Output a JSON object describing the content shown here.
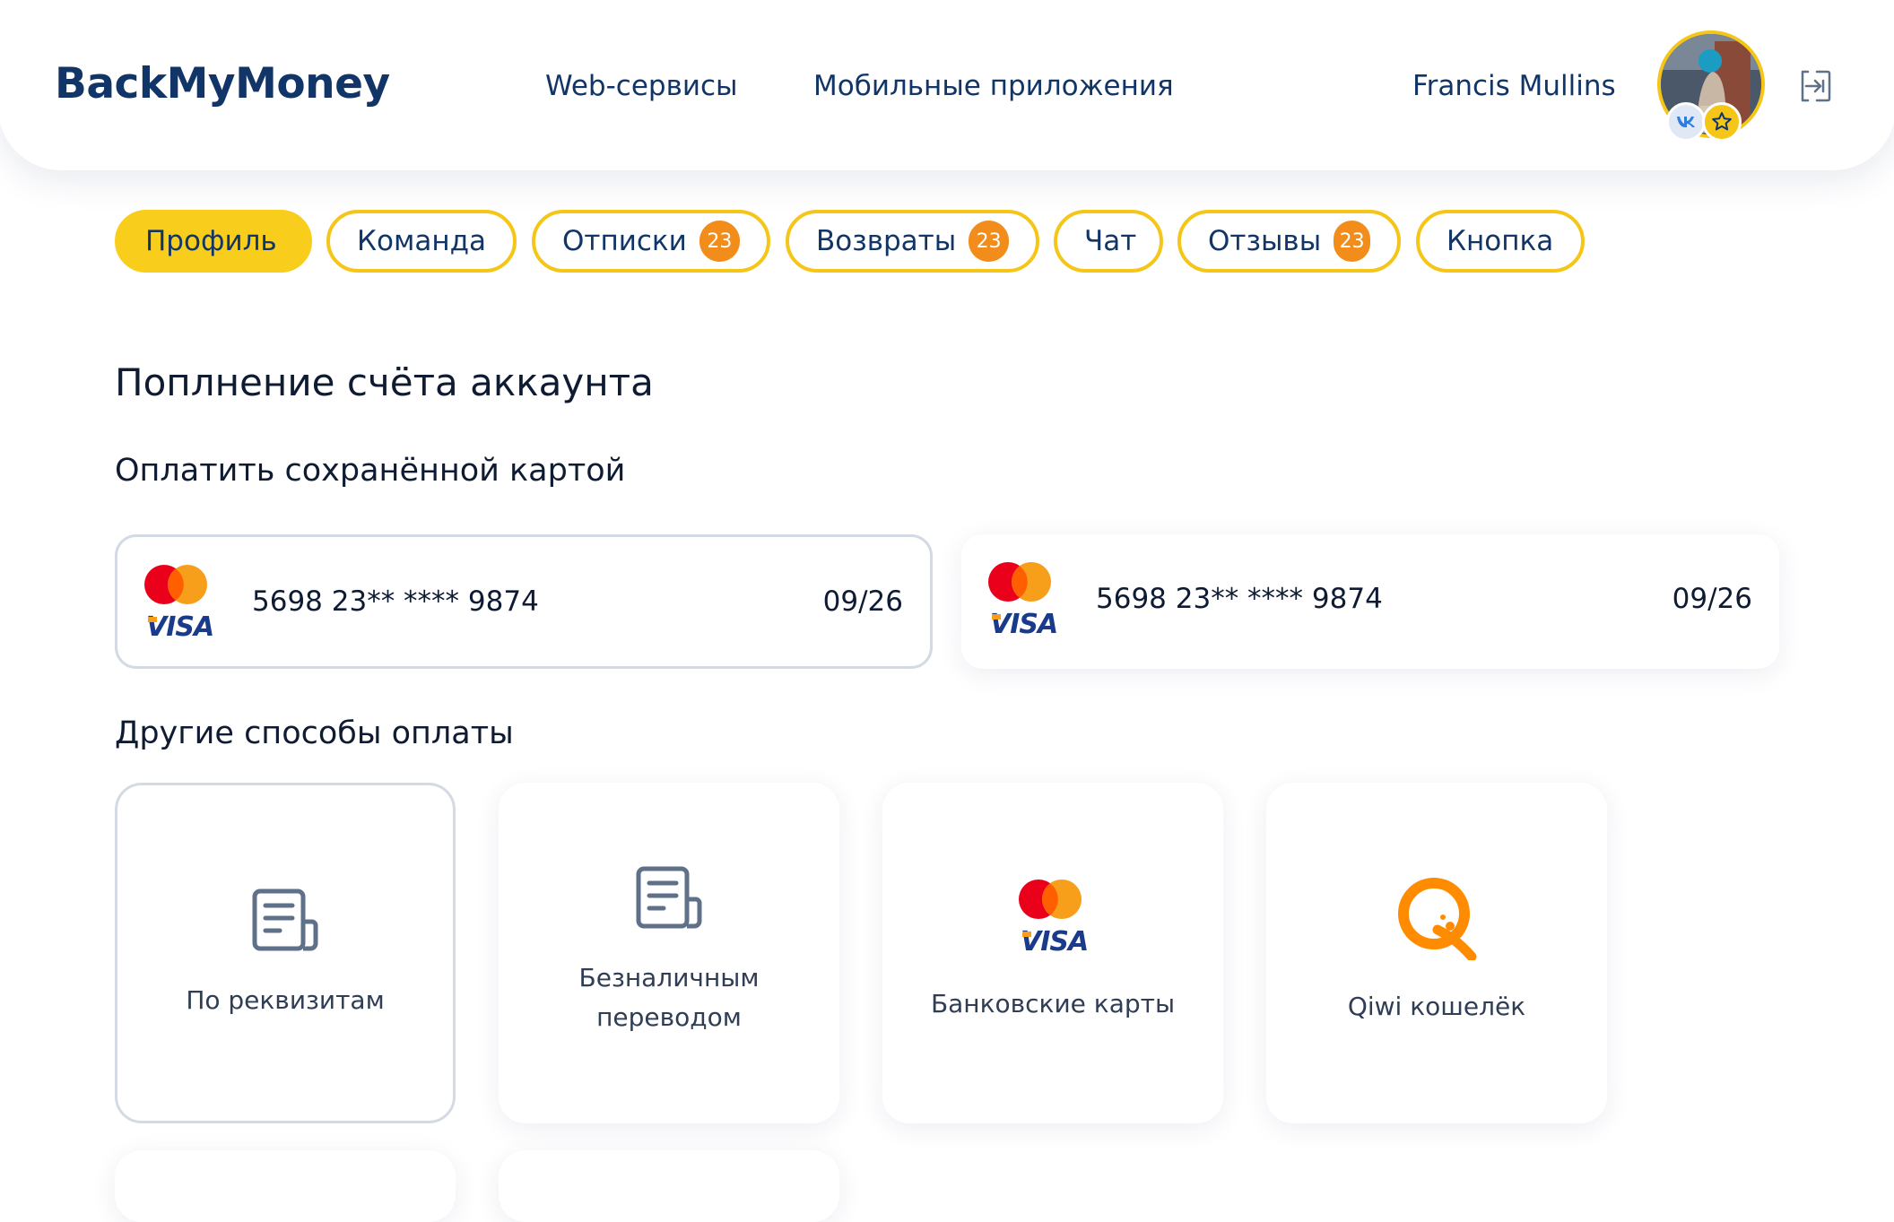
{
  "header": {
    "brand": "BackMyMoney",
    "nav": [
      {
        "label": "Web-сервисы"
      },
      {
        "label": "Мобильные приложения"
      }
    ],
    "user_name": "Francis Mullins"
  },
  "tabs": [
    {
      "label": "Профиль",
      "active": true
    },
    {
      "label": "Команда"
    },
    {
      "label": "Отписки",
      "badge": "23"
    },
    {
      "label": "Возвраты",
      "badge": "23"
    },
    {
      "label": "Чат"
    },
    {
      "label": "Отзывы",
      "badge": "23"
    },
    {
      "label": "Кнопка"
    }
  ],
  "page": {
    "title": "Поплнение счёта аккаунта",
    "saved_title": "Оплатить сохранённой картой",
    "other_title": "Другие способы оплаты"
  },
  "saved_cards": [
    {
      "number": "5698 23** **** 9874",
      "expiry": "09/26",
      "brand_text": "VISA",
      "selected": true
    },
    {
      "number": "5698 23** **** 9874",
      "expiry": "09/26",
      "brand_text": "VISA"
    }
  ],
  "methods": [
    {
      "label": "По реквизитам",
      "icon": "document-icon",
      "selected": true
    },
    {
      "label_line1": "Безналичным",
      "label_line2": "переводом",
      "icon": "document-icon"
    },
    {
      "label": "Банковские карты",
      "icon": "mastercard-visa-icon",
      "brand_text": "VISA"
    },
    {
      "label": "Qiwi кошелёк",
      "icon": "qiwi-icon"
    }
  ],
  "colors": {
    "accent_yellow": "#f9cd1c",
    "badge_orange": "#f28c1a",
    "navy": "#123567",
    "mc_red": "#eb001b",
    "mc_orange": "#f79e1b",
    "visa_blue": "#1a3a8c",
    "qiwi_orange": "#ff8c00",
    "icon_grey": "#5f7189"
  }
}
